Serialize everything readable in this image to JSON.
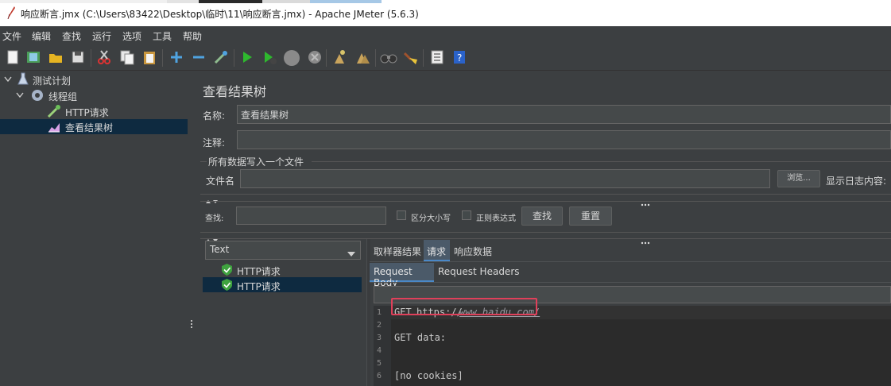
{
  "window": {
    "title": "响应断言.jmx (C:\\Users\\83422\\Desktop\\临时\\11\\响应断言.jmx) - Apache JMeter (5.6.3)"
  },
  "menu": [
    "文件",
    "编辑",
    "查找",
    "运行",
    "选项",
    "工具",
    "帮助"
  ],
  "tree": {
    "items": [
      {
        "label": "测试计划"
      },
      {
        "label": "线程组"
      },
      {
        "label": "HTTP请求"
      },
      {
        "label": "查看结果树"
      }
    ]
  },
  "panel": {
    "title": "查看结果树",
    "name_label": "名称:",
    "name_value": "查看结果树",
    "comment_label": "注释:",
    "comment_value": "",
    "file_group_label": "所有数据写入一个文件",
    "filename_label": "文件名",
    "filename_value": "",
    "browse_button": "浏览...",
    "log_content_label": "显示日志内容:",
    "search_label": "查找:",
    "search_value": "",
    "case_sensitive_label": "区分大小写",
    "regex_label": "正则表达式",
    "search_button": "查找",
    "reset_button": "重置"
  },
  "renderer": {
    "selected": "Text"
  },
  "results": [
    {
      "label": "HTTP请求",
      "status": "success"
    },
    {
      "label": "HTTP请求",
      "status": "success"
    }
  ],
  "tabs": {
    "items": [
      "取样器结果",
      "请求",
      "响应数据"
    ],
    "active": "请求"
  },
  "subtabs": {
    "items": [
      "Request Body",
      "Request Headers"
    ],
    "active": "Request Body"
  },
  "request_body": {
    "lines": [
      {
        "num": "1",
        "prefix": "GET ",
        "text": "https://",
        "link": "www.baidu.com/"
      },
      {
        "num": "2",
        "text": ""
      },
      {
        "num": "3",
        "text": "GET data:"
      },
      {
        "num": "4",
        "text": ""
      },
      {
        "num": "5",
        "text": ""
      },
      {
        "num": "6",
        "text": "[no cookies]"
      }
    ]
  },
  "colors": {
    "background": "#3c3f41",
    "selection": "#0e2a40",
    "highlight_box": "#e0405a",
    "success": "#3fa33f"
  }
}
